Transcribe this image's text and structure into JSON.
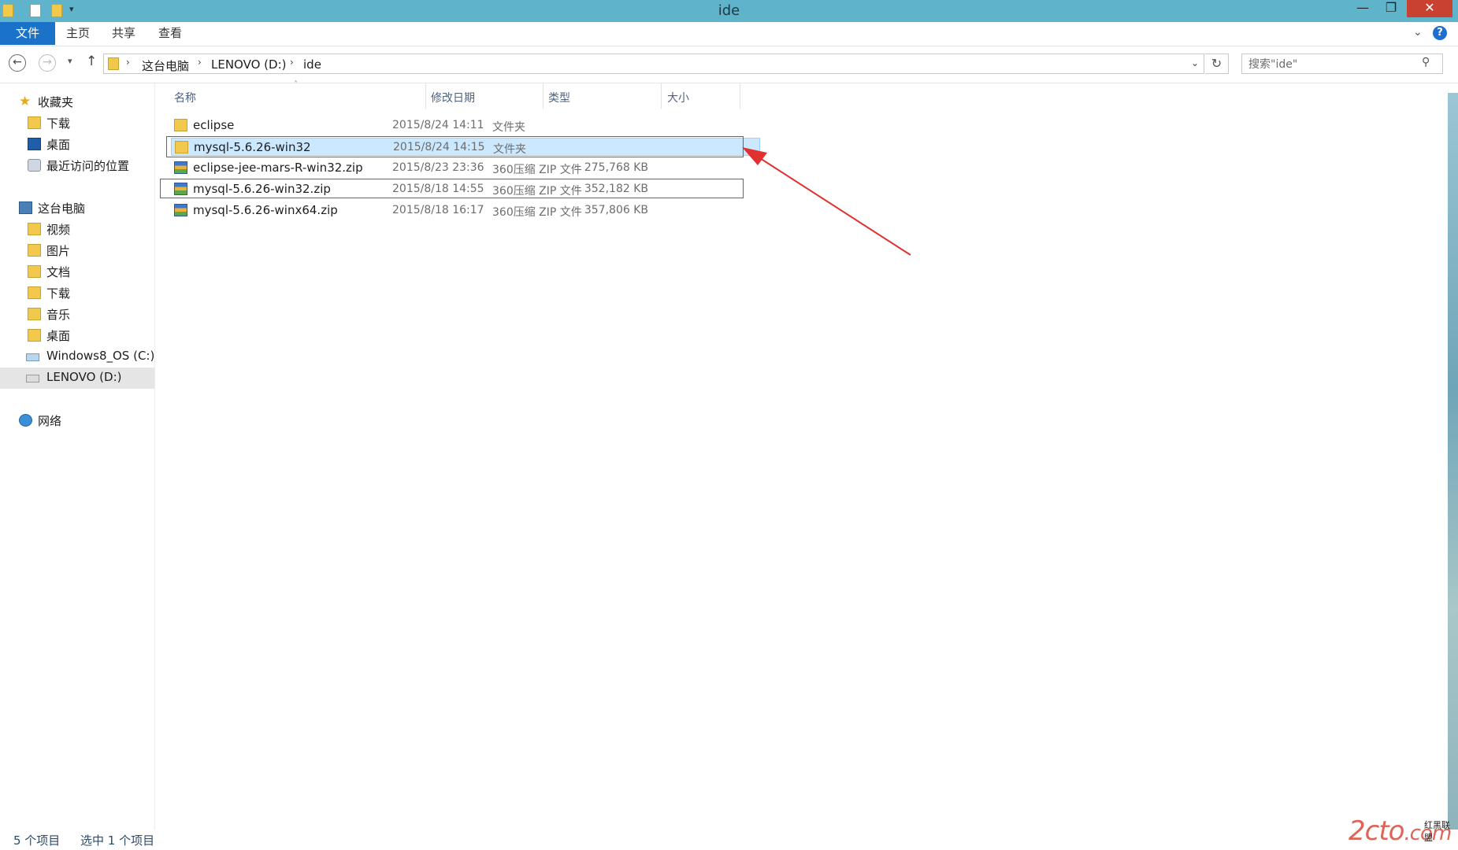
{
  "window": {
    "title": "ide",
    "minimize_glyph": "—",
    "restore_glyph": "❐",
    "close_glyph": "✕"
  },
  "ribbon": {
    "tabs": [
      "文件",
      "主页",
      "共享",
      "查看"
    ],
    "help_glyph": "?"
  },
  "address": {
    "breadcrumb": [
      "这台电脑",
      "LENOVO (D:)",
      "ide"
    ],
    "search_placeholder": "搜索\"ide\""
  },
  "nav_pane": {
    "favorites": {
      "label": "收藏夹",
      "items": [
        "下载",
        "桌面",
        "最近访问的位置"
      ]
    },
    "this_pc": {
      "label": "这台电脑",
      "items": [
        "视频",
        "图片",
        "文档",
        "下载",
        "音乐",
        "桌面",
        "Windows8_OS (C:)",
        "LENOVO (D:)"
      ]
    },
    "network": {
      "label": "网络"
    }
  },
  "file_list": {
    "columns": {
      "name": "名称",
      "modified": "修改日期",
      "type": "类型",
      "size": "大小"
    },
    "rows": [
      {
        "name": "eclipse",
        "modified": "2015/8/24 14:11",
        "type": "文件夹",
        "size": "",
        "icon": "folder-icon"
      },
      {
        "name": "mysql-5.6.26-win32",
        "modified": "2015/8/24 14:15",
        "type": "文件夹",
        "size": "",
        "icon": "folder-icon",
        "selected": true
      },
      {
        "name": "eclipse-jee-mars-R-win32.zip",
        "modified": "2015/8/23 23:36",
        "type": "360压缩 ZIP 文件",
        "size": "275,768 KB",
        "icon": "zip-archive-icon"
      },
      {
        "name": "mysql-5.6.26-win32.zip",
        "modified": "2015/8/18 14:55",
        "type": "360压缩 ZIP 文件",
        "size": "352,182 KB",
        "icon": "zip-archive-icon"
      },
      {
        "name": "mysql-5.6.26-winx64.zip",
        "modified": "2015/8/18 16:17",
        "type": "360压缩 ZIP 文件",
        "size": "357,806 KB",
        "icon": "zip-archive-icon"
      }
    ]
  },
  "status_bar": {
    "item_count": "5 个项目",
    "selection": "选中 1 个项目"
  },
  "watermark": {
    "text": "2cto",
    "suffix": ".com",
    "sub": "红黑联盟"
  },
  "colors": {
    "titlebar": "#5fb3ca",
    "file_tab": "#1a73c8",
    "close_button": "#c94131",
    "selection": "#cce8ff",
    "annotation": "#e03030"
  }
}
